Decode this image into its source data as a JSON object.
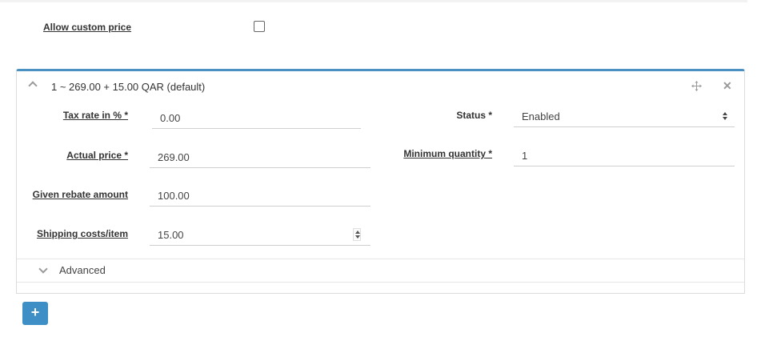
{
  "custom_price": {
    "label": "Allow custom price",
    "checked": false
  },
  "price_panel": {
    "title": "1 ~ 269.00 + 15.00 QAR (default)",
    "icons": [
      "chevron-up-icon",
      "move-icon",
      "close-icon"
    ],
    "fields": {
      "tax_rate": {
        "label": "Tax rate in % *",
        "value": "0.00"
      },
      "actual_price": {
        "label": "Actual price *",
        "value": "269.00"
      },
      "rebate": {
        "label": "Given rebate amount",
        "value": "100.00"
      },
      "shipping": {
        "label": "Shipping costs/item",
        "value": "15.00"
      },
      "status": {
        "label": "Status *",
        "value": "Enabled"
      },
      "min_quantity": {
        "label": "Minimum quantity *",
        "value": "1"
      }
    },
    "advanced": {
      "label": "Advanced"
    }
  },
  "add_button": {
    "label": "+"
  },
  "colors": {
    "accent": "#4a90c0",
    "button": "#3d8fc6"
  }
}
